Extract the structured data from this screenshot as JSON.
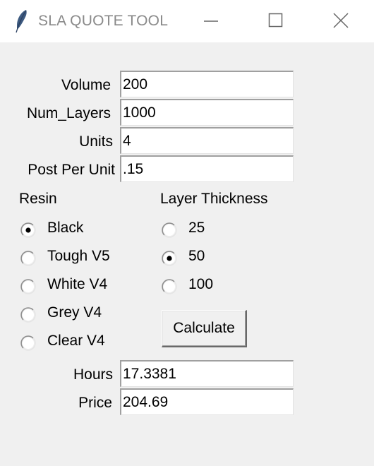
{
  "window": {
    "title": "SLA QUOTE TOOL",
    "icon": "feather-icon",
    "controls": [
      "minimize-icon",
      "maximize-icon",
      "close-icon"
    ]
  },
  "form": {
    "volume": {
      "label": "Volume",
      "value": "200"
    },
    "num_layers": {
      "label": "Num_Layers",
      "value": "1000"
    },
    "units": {
      "label": "Units",
      "value": "4"
    },
    "post_per_unit": {
      "label": "Post Per Unit",
      "value": ".15"
    }
  },
  "resin": {
    "label": "Resin",
    "selected": "Black",
    "options": [
      "Black",
      "Tough V5",
      "White V4",
      "Grey V4",
      "Clear V4"
    ]
  },
  "layer_thickness": {
    "label": "Layer Thickness",
    "selected": "50",
    "options": [
      "25",
      "50",
      "100"
    ]
  },
  "calculate_label": "Calculate",
  "results": {
    "hours": {
      "label": "Hours",
      "value": "17.3381"
    },
    "price": {
      "label": "Price",
      "value": "204.69"
    }
  }
}
